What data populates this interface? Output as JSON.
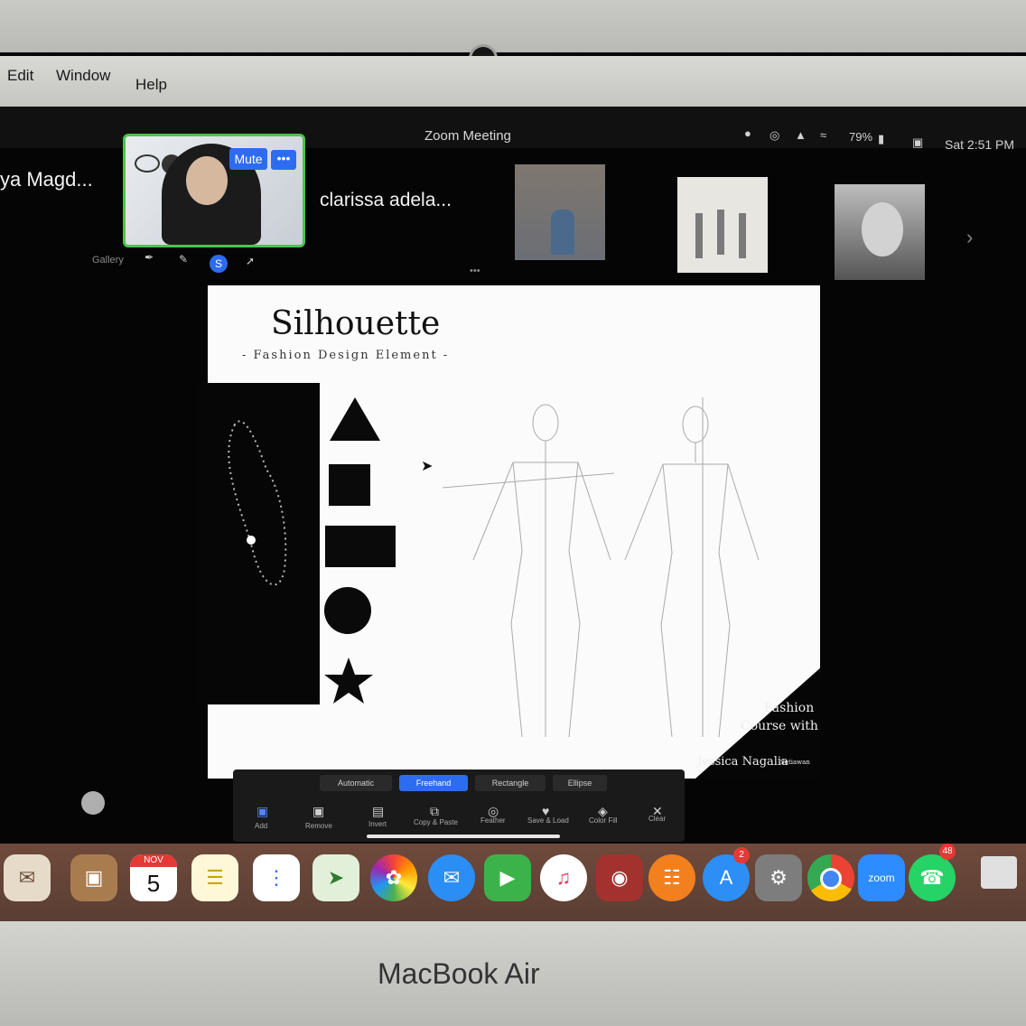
{
  "menubar": {
    "items": [
      "Edit",
      "Window",
      "Help"
    ]
  },
  "zoom_window": {
    "title": "Zoom Meeting",
    "status": {
      "battery": "79%",
      "clock": "Sat 2:51 PM"
    }
  },
  "participants": {
    "left_name": "ya Magd...",
    "self_controls": {
      "mute_label": "Mute",
      "more_label": "•••"
    },
    "right_name": "clarissa adela..."
  },
  "annotation_top": {
    "gallery_label": "Gallery",
    "more_dots": "•••"
  },
  "slide": {
    "title": "Silhouette",
    "subtitle": "- Fashion Design Element -",
    "credit_line1": "Fashion",
    "credit_line2": "Course with",
    "credit_name": "Jessica Nagalia",
    "credit_suffix": "Setiawan"
  },
  "whiteboard_modes": [
    "Automatic",
    "Freehand",
    "Rectangle",
    "Ellipse"
  ],
  "whiteboard_tools": [
    "Add",
    "Remove",
    "Invert",
    "Copy & Paste",
    "Feather",
    "Save & Load",
    "Color Fill",
    "Clear"
  ],
  "dock": {
    "calendar_month": "NOV",
    "calendar_day": "5",
    "appstore_badge": "2",
    "zoom_label": "zoom",
    "whatsapp_badge": "48"
  },
  "laptop": {
    "brand": "MacBook Air"
  }
}
